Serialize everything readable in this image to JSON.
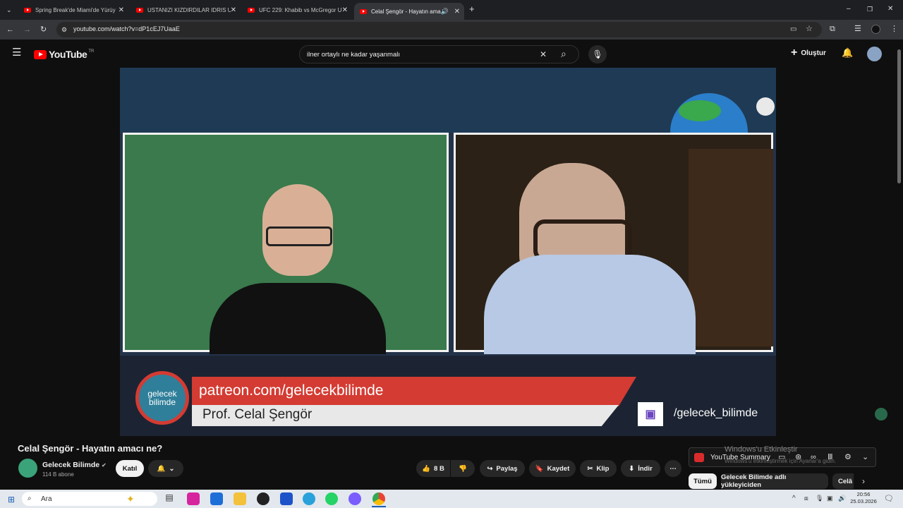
{
  "browser": {
    "tabs": [
      {
        "title": "Spring Break'de Miami'de Yürüy"
      },
      {
        "title": "USTANIZI KIZDIRDILAR IDRIS U"
      },
      {
        "title": "UFC 229: Khabib vs McGregor U"
      },
      {
        "title": "Celal Şengör - Hayatın ama"
      }
    ],
    "url": "youtube.com/watch?v=dP1cEJ7UaaE"
  },
  "youtube": {
    "brand": "YouTube",
    "region": "TR",
    "search_value": "ilner ortaylı ne kadar yaşanmalı",
    "create_label": "Oluştur"
  },
  "video_overlay": {
    "patreon": "patreon.com/gelecekbilimde",
    "guest": "Prof. Celal Şengör",
    "logo_text_1": "gelecek",
    "logo_text_2": "bilimde",
    "handle": "/gelecek_bilimde"
  },
  "video": {
    "title": "Celal Şengör - Hayatın amacı ne?",
    "channel": "Gelecek Bilimde",
    "subscribers": "114 B abone",
    "join_label": "Katıl",
    "likes": "8 B",
    "share_label": "Paylaş",
    "save_label": "Kaydet",
    "clip_label": "Klip",
    "download_label": "İndir"
  },
  "summary_ext": {
    "label": "YouTube Summary",
    "watermark_1": "Windows'u Etkinleştir",
    "watermark_2": "Windows'u etkinleştirmek için Ayarlar'a gidin."
  },
  "chips": [
    "Tümü",
    "Gelecek Bilimde adlı yükleyiciden",
    "Celâ"
  ],
  "taskbar": {
    "search_placeholder": "Ara",
    "time": "20:56",
    "date": "25.03.2026"
  }
}
